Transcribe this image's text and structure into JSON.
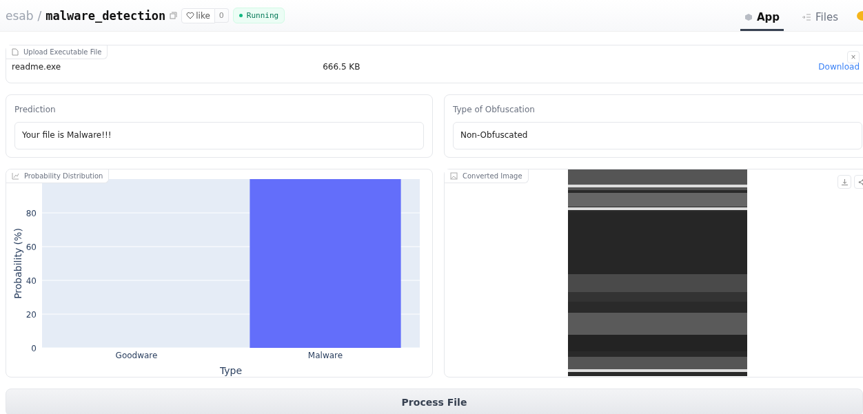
{
  "header": {
    "owner": "esab",
    "separator": "/",
    "repo": "malware_detection",
    "like_label": "like",
    "like_count": "0",
    "status": "Running",
    "tabs": [
      {
        "label": "App",
        "selected": true
      },
      {
        "label": "Files",
        "selected": false
      }
    ]
  },
  "upload": {
    "label": "Upload Executable File",
    "close": "×",
    "file_name": "readme.exe",
    "file_size": "666.5 KB",
    "download": "Download"
  },
  "prediction": {
    "label": "Prediction",
    "value": "Your file is Malware!!!"
  },
  "obfuscation": {
    "label": "Type of Obfuscation",
    "value": "Non-Obfuscated"
  },
  "probability": {
    "label": "Probability Distribution",
    "chart_data": {
      "type": "bar",
      "xlabel": "Type",
      "ylabel": "Probability (%)",
      "categories": [
        "Goodware",
        "Malware"
      ],
      "values": [
        0,
        100
      ],
      "ylim": [
        0,
        100
      ],
      "yticks": [
        0,
        20,
        40,
        60,
        80
      ],
      "grid": true
    }
  },
  "converted_image": {
    "label": "Converted Image"
  },
  "process_button": "Process File"
}
